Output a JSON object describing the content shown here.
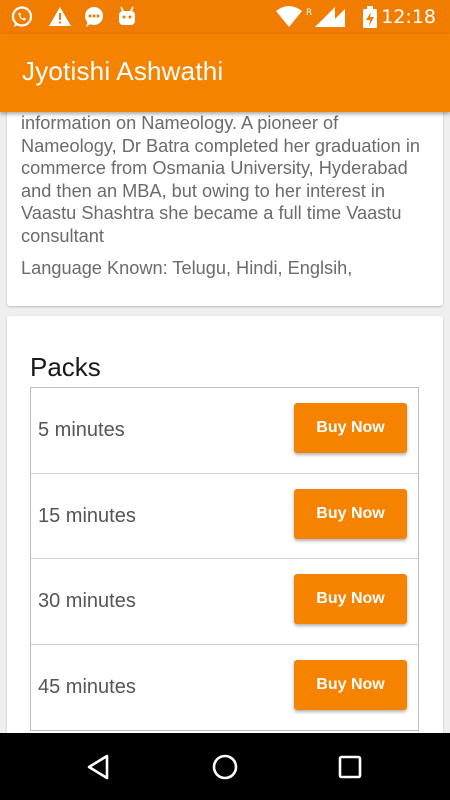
{
  "status_bar": {
    "time": "12:18",
    "icons": [
      "whatsapp-icon",
      "warning-icon",
      "speech-bubble-icon",
      "android-icon",
      "wifi-icon",
      "signal-icon",
      "battery-charging-icon"
    ]
  },
  "app_bar": {
    "title": "Jyotishi Ashwathi"
  },
  "about": {
    "text": "information on Nameology. A pioneer of Nameology, Dr Batra completed her graduation in commerce from Osmania University, Hyderabad and then an MBA, but owing to her interest in Vaastu Shashtra she became a full time Vaastu consultant",
    "languages": "Language Known: Telugu, Hindi, Englsih,"
  },
  "packs": {
    "title": "Packs",
    "items": [
      {
        "label": "5 minutes",
        "button": "Buy Now"
      },
      {
        "label": "15 minutes",
        "button": "Buy Now"
      },
      {
        "label": "30 minutes",
        "button": "Buy Now"
      },
      {
        "label": "45 minutes",
        "button": "Buy Now"
      }
    ]
  },
  "nav_bar": {
    "buttons": [
      "back-icon",
      "home-icon",
      "recents-icon"
    ]
  },
  "colors": {
    "accent": "#f58300",
    "status_bar": "#f07c00",
    "nav_bar": "#000000",
    "body_text": "#6b6b6b"
  }
}
